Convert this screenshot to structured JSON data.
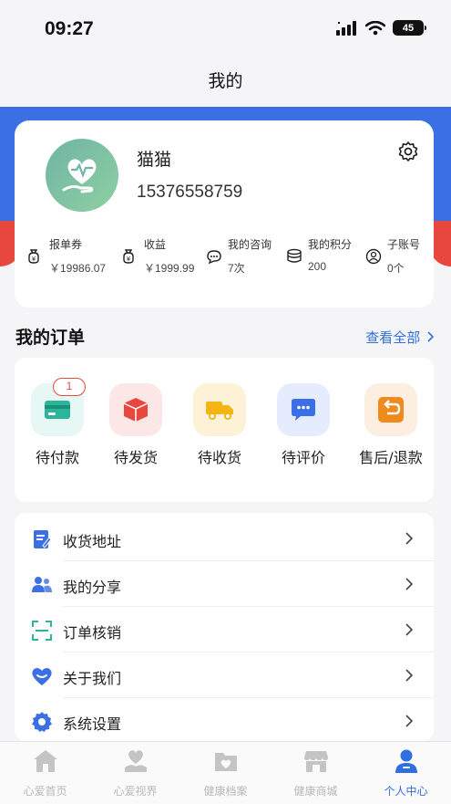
{
  "status_bar": {
    "time": "09:27",
    "battery": "45"
  },
  "nav": {
    "title": "我的"
  },
  "profile": {
    "username": "猫猫",
    "phone": "15376558759",
    "stats": [
      {
        "label": "报单券",
        "value": "￥19986.07",
        "icon": "money-bag-icon"
      },
      {
        "label": "收益",
        "value": "￥1999.99",
        "icon": "money-bag-icon"
      },
      {
        "label": "我的咨询",
        "value": "7次",
        "icon": "chat-bubble-icon"
      },
      {
        "label": "我的积分",
        "value": "200",
        "icon": "coins-stack-icon"
      },
      {
        "label": "子账号",
        "value": "0个",
        "icon": "user-circle-icon"
      }
    ]
  },
  "orders": {
    "title": "我的订单",
    "view_all": "查看全部",
    "items": [
      {
        "label": "待付款",
        "badge": "1",
        "icon": "card-icon",
        "bg": "#e6f7f4",
        "color": "#2bb59b"
      },
      {
        "label": "待发货",
        "icon": "box-icon",
        "bg": "#fde7e6",
        "color": "#e8473d"
      },
      {
        "label": "待收货",
        "icon": "truck-icon",
        "bg": "#fdf1d6",
        "color": "#f3b414"
      },
      {
        "label": "待评价",
        "icon": "comment-icon",
        "bg": "#e4ecfd",
        "color": "#3b6fe4"
      },
      {
        "label": "售后/退款",
        "icon": "return-icon",
        "bg": "#fdeee2",
        "color": "#f08a1c"
      }
    ]
  },
  "menu": [
    {
      "label": "收货地址",
      "icon": "address-icon"
    },
    {
      "label": "我的分享",
      "icon": "share-users-icon"
    },
    {
      "label": "订单核销",
      "icon": "scan-icon"
    },
    {
      "label": "关于我们",
      "icon": "heart-icon"
    },
    {
      "label": "系统设置",
      "icon": "settings-icon"
    }
  ],
  "tabbar": [
    {
      "label": "心爱首页",
      "icon": "home-icon",
      "active": false
    },
    {
      "label": "心爱视界",
      "icon": "heart-hand-icon",
      "active": false
    },
    {
      "label": "健康档案",
      "icon": "folder-heart-icon",
      "active": false
    },
    {
      "label": "健康商城",
      "icon": "store-icon",
      "active": false
    },
    {
      "label": "个人中心",
      "icon": "person-icon",
      "active": true
    }
  ],
  "colors": {
    "primary": "#3b6fe4",
    "accent_red": "#e8473d",
    "link": "#2f6fdf"
  }
}
